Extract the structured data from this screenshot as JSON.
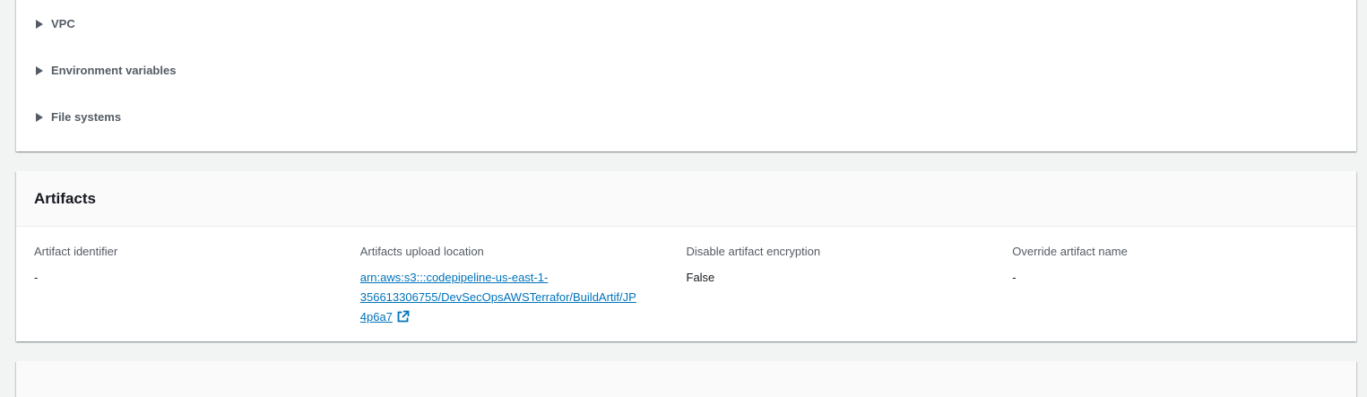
{
  "top_section": {
    "expanders": [
      {
        "label": "VPC"
      },
      {
        "label": "Environment variables"
      },
      {
        "label": "File systems"
      }
    ]
  },
  "artifacts": {
    "title": "Artifacts",
    "fields": {
      "identifier": {
        "label": "Artifact identifier",
        "value": "-"
      },
      "upload_location": {
        "label": "Artifacts upload location",
        "line1": "arn:aws:s3:::codepipeline-us-east-1-",
        "line2": "356613306755/DevSecOpsAWSTerrafor/BuildArtif/JP",
        "line3": "4p6a7"
      },
      "encryption": {
        "label": "Disable artifact encryption",
        "value": "False"
      },
      "override_name": {
        "label": "Override artifact name",
        "value": "-"
      }
    }
  },
  "colors": {
    "background": "#f2f3f3",
    "link": "#0073bb",
    "label": "#545b64",
    "text": "#16191f"
  },
  "icons": {
    "expander": "caret-right-icon",
    "external": "external-link-icon"
  }
}
